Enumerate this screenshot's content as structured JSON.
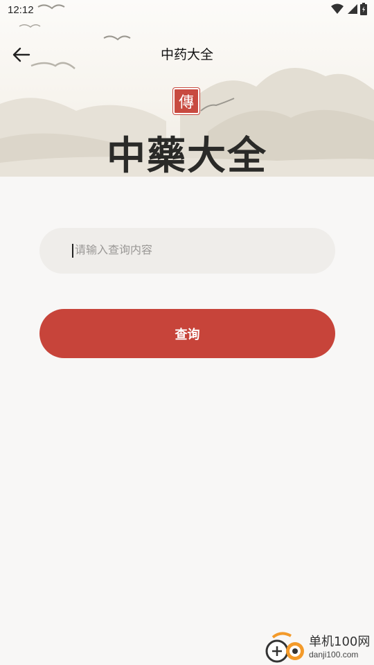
{
  "status_bar": {
    "time": "12:12",
    "icons": [
      "wifi-icon",
      "signal-icon",
      "battery-icon"
    ]
  },
  "nav": {
    "back_icon": "arrow-left-icon",
    "title": "中药大全"
  },
  "banner": {
    "seal_text": "傳",
    "title": "中藥大全"
  },
  "search": {
    "placeholder": "请输入查询内容",
    "value": ""
  },
  "query_button": {
    "label": "查询"
  },
  "watermark": {
    "name": "单机100网",
    "url": "danji100.com"
  },
  "colors": {
    "accent": "#c7443a",
    "background": "#f8f7f6",
    "input_bg": "#efedea"
  }
}
